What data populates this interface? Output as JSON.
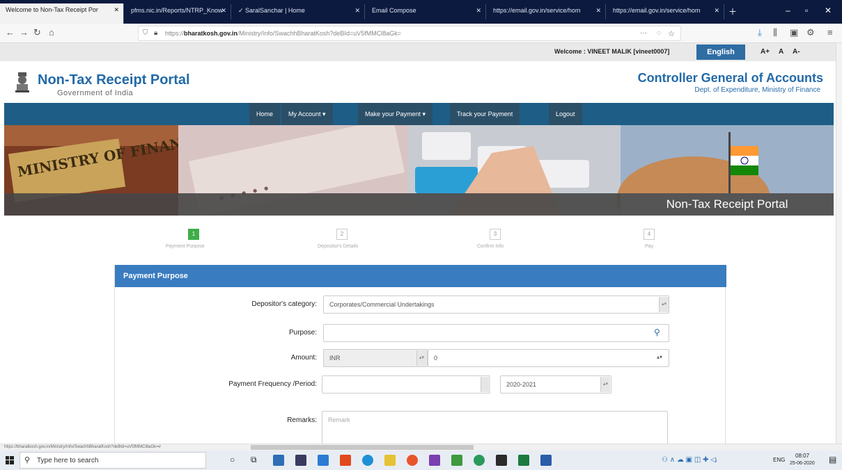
{
  "browser": {
    "tabs": [
      {
        "label": "Welcome to Non-Tax Receipt Por"
      },
      {
        "label": "pfms.nic.in/Reports/NTRP_Know"
      },
      {
        "label": "✓ SaralSanchar | Home"
      },
      {
        "label": "Email Compose"
      },
      {
        "label": "https://email.gov.in/service/hom"
      },
      {
        "label": "https://email.gov.in/service/hom"
      }
    ],
    "url_prefix": "https://",
    "url_domain": "bharatkosh.gov.in",
    "url_path": "/Ministry/Info/SwachhBharatKosh?deBId=uV5fMMCl8aGk="
  },
  "site": {
    "welcome": "Welcome : VINEET MALIK [vineet0007]",
    "language": "English",
    "font_sizes": [
      "A+",
      "A",
      "A-"
    ],
    "portal_title": "Non-Tax Receipt Portal",
    "portal_subtitle": "Government of India",
    "cga_title": "Controller General of Accounts",
    "cga_subtitle": "Dept. of Expenditure, Ministry of Finance",
    "menu": [
      "Home",
      "My Account ▾",
      "Make your Payment ▾",
      "Track your Payment",
      "Logout"
    ],
    "banner_label": "Non-Tax Receipt Portal",
    "banner_sign": "MINISTRY OF FINANCE"
  },
  "steps": [
    {
      "num": "1",
      "label": "Payment Purpose"
    },
    {
      "num": "2",
      "label": "Depositor's Details"
    },
    {
      "num": "3",
      "label": "Confirm Info"
    },
    {
      "num": "4",
      "label": "Pay"
    }
  ],
  "form": {
    "title": "Payment Purpose",
    "category_label": "Depositor's category:",
    "category_value": "Corporates/Commercial Undertakings",
    "purpose_label": "Purpose:",
    "purpose_value": "",
    "amount_label": "Amount:",
    "currency": "INR",
    "amount_value": "0",
    "frequency_label": "Payment Frequency /Period:",
    "frequency_value": "",
    "period_value": "2020-2021",
    "remarks_label": "Remarks:",
    "remarks_placeholder": "Remark"
  },
  "status_url": "https://bharatkosh.gov.in/Ministry/Info/SwachhBharatKosh?deBId=uV5fMMCl8aGk=#",
  "taskbar": {
    "search_placeholder": "Type here to search",
    "tray_lang": "ENG",
    "time": "08:07",
    "date": "25-06-2020"
  }
}
